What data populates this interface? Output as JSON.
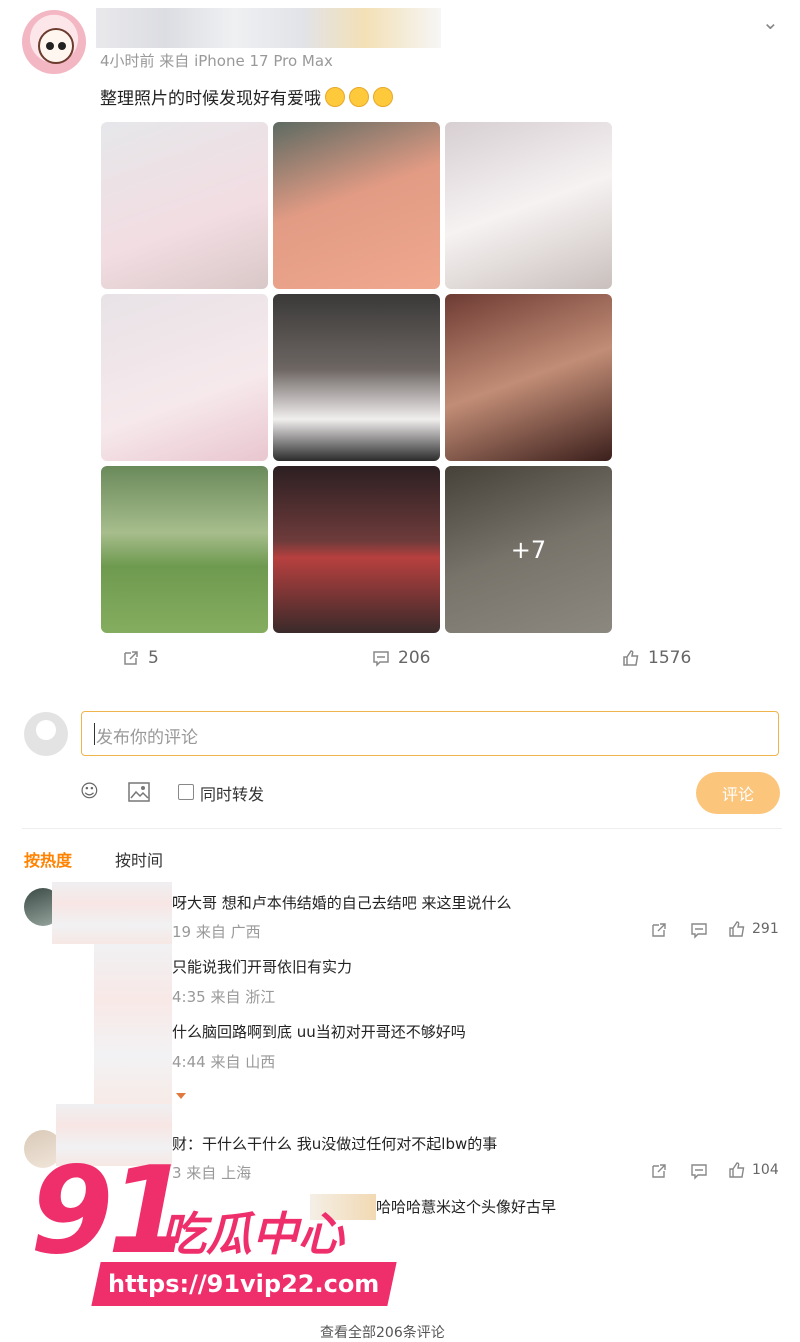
{
  "post": {
    "meta": "4小时前 来自 iPhone 17 Pro Max",
    "text": "整理照片的时候发现好有爱哦",
    "more_count": "+7",
    "reposts": "5",
    "comments": "206",
    "likes": "1576"
  },
  "composer": {
    "placeholder": "发布你的评论",
    "repost_label": "同时转发",
    "submit_label": "评论"
  },
  "sort_tabs": {
    "hot": "按热度",
    "time": "按时间"
  },
  "comments": [
    {
      "text": "呀大哥 想和卢本伟结婚的自己去结吧 来这里说什么",
      "meta": "19 来自 广西",
      "likes": "291",
      "replies": [
        {
          "text": "只能说我们开哥依旧有实力",
          "meta": "4:35 来自 浙江"
        },
        {
          "text": "什么脑回路啊到底 uu当初对开哥还不够好吗",
          "meta": "4:44 来自 山西"
        }
      ]
    },
    {
      "text": "财：干什么干什么 我u没做过任何对不起lbw的事",
      "meta": "3 来自 上海",
      "likes": "104",
      "replies": [
        {
          "text": "哈哈哈薏米这个头像好古早"
        }
      ]
    }
  ],
  "watermark": {
    "number": "91",
    "title": "吃瓜中心",
    "url": "https://91vip22.com"
  },
  "footer_partial": "查看全部206条评论"
}
